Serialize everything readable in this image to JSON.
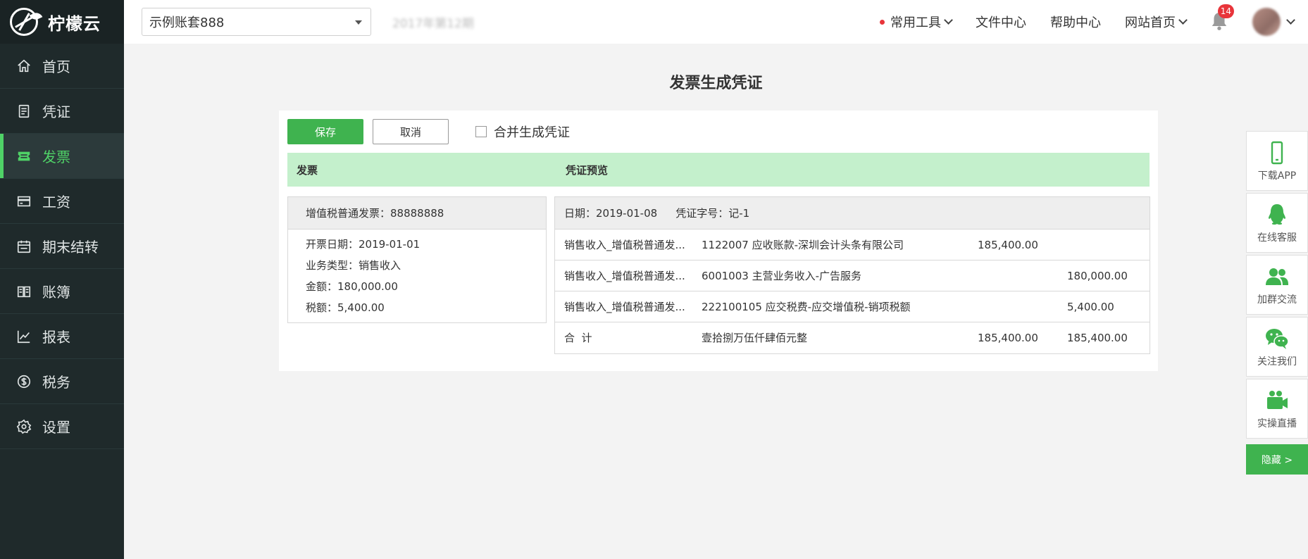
{
  "brand": {
    "name": "柠檬云"
  },
  "sidebar": {
    "items": [
      {
        "label": "首页",
        "icon": "home-icon"
      },
      {
        "label": "凭证",
        "icon": "voucher-icon"
      },
      {
        "label": "发票",
        "icon": "invoice-icon",
        "active": true
      },
      {
        "label": "工资",
        "icon": "salary-card-icon"
      },
      {
        "label": "期末结转",
        "icon": "calendar-icon"
      },
      {
        "label": "账簿",
        "icon": "book-icon"
      },
      {
        "label": "报表",
        "icon": "chart-icon"
      },
      {
        "label": "税务",
        "icon": "dollar-icon"
      },
      {
        "label": "设置",
        "icon": "gear-icon"
      }
    ]
  },
  "topbar": {
    "account": "示例账套888",
    "period": "2017年第12期",
    "tools": "常用工具",
    "files": "文件中心",
    "help": "帮助中心",
    "site": "网站首页",
    "notifications": "14"
  },
  "page": {
    "title": "发票生成凭证",
    "save": "保存",
    "cancel": "取消",
    "merge": "合并生成凭证",
    "col_invoice": "发票",
    "col_preview": "凭证预览"
  },
  "invoice": {
    "header": "增值税普通发票：88888888",
    "lines": [
      "开票日期：2019-01-01",
      "业务类型：销售收入",
      "金额：180,000.00",
      "税额：5,400.00"
    ]
  },
  "voucher": {
    "date": "日期：2019-01-08",
    "number": "凭证字号：记-1",
    "rows": [
      {
        "summary": "销售收入_增值税普通发...",
        "account": "1122007 应收账款-深圳会计头条有限公司",
        "debit": "185,400.00",
        "credit": ""
      },
      {
        "summary": "销售收入_增值税普通发...",
        "account": "6001003 主营业务收入-广告服务",
        "debit": "",
        "credit": "180,000.00"
      },
      {
        "summary": "销售收入_增值税普通发...",
        "account": "222100105 应交税费-应交增值税-销项税额",
        "debit": "",
        "credit": "5,400.00"
      },
      {
        "summary": "合  计",
        "account": "壹拾捌万伍仟肆佰元整",
        "debit": "185,400.00",
        "credit": "185,400.00"
      }
    ]
  },
  "float": {
    "items": [
      {
        "label": "下载APP",
        "icon": "phone-icon"
      },
      {
        "label": "在线客服",
        "icon": "qq-icon"
      },
      {
        "label": "加群交流",
        "icon": "group-icon"
      },
      {
        "label": "关注我们",
        "icon": "wechat-icon"
      },
      {
        "label": "实操直播",
        "icon": "video-icon"
      }
    ],
    "hide": "隐藏 >"
  },
  "colors": {
    "sidebar": "#1f2a2b",
    "accent": "#3fb34f",
    "active_text": "#4fd267",
    "head_bar": "#c4f0cc"
  }
}
